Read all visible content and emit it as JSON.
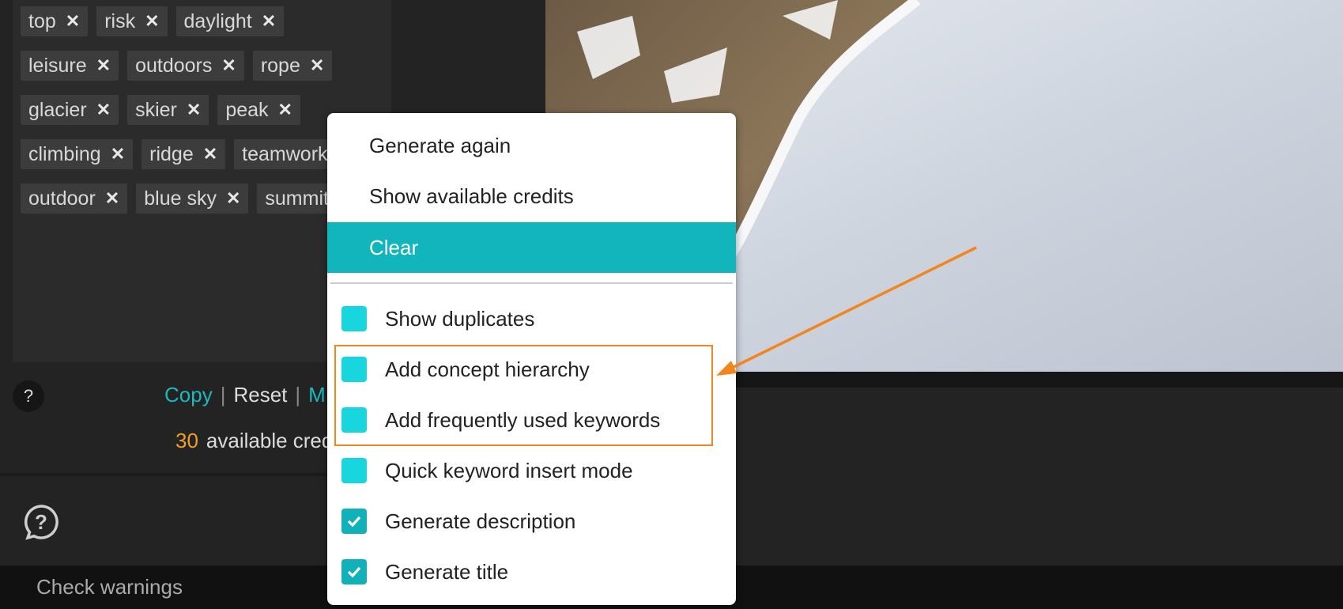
{
  "keywords": [
    {
      "label": "top"
    },
    {
      "label": "risk"
    },
    {
      "label": "daylight"
    },
    {
      "label": "leisure"
    },
    {
      "label": "outdoors"
    },
    {
      "label": "rope"
    },
    {
      "label": "glacier"
    },
    {
      "label": "skier"
    },
    {
      "label": "peak"
    },
    {
      "label": "climbing"
    },
    {
      "label": "ridge"
    },
    {
      "label": "teamwork"
    },
    {
      "label": "outdoor"
    },
    {
      "label": "blue sky"
    },
    {
      "label": "summit"
    }
  ],
  "remove_glyph": "✕",
  "help_label": "?",
  "actions": {
    "copy": "Copy",
    "reset": "Reset",
    "more_partial": "M",
    "separator": "|"
  },
  "credits": {
    "count": "30",
    "label": "available credits"
  },
  "bottom": {
    "check_warnings": "Check warnings"
  },
  "menu": {
    "items": [
      {
        "label": "Generate again"
      },
      {
        "label": "Show available credits"
      },
      {
        "label": "Clear"
      }
    ],
    "options": [
      {
        "label": "Show duplicates",
        "checked": false
      },
      {
        "label": "Add concept hierarchy",
        "checked": false
      },
      {
        "label": "Add frequently used keywords",
        "checked": false
      },
      {
        "label": "Quick keyword insert mode",
        "checked": false
      },
      {
        "label": "Generate description",
        "checked": true
      },
      {
        "label": "Generate title",
        "checked": true
      }
    ]
  },
  "colors": {
    "accent": "#12b5bb",
    "checkbox": "#19d6de",
    "credits_number": "#f2a020",
    "annotation": "#f3851e"
  }
}
